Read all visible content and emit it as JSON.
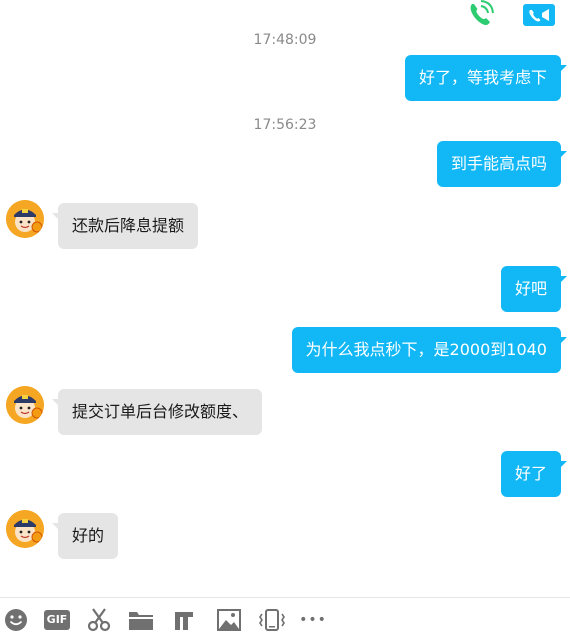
{
  "header": {
    "call_icon": "phone-call-icon",
    "video_icon": "video-call-icon",
    "accent_call": "#2ecc71",
    "accent_video": "#12b7f5"
  },
  "messages": [
    {
      "type": "time",
      "text": "17:48:09"
    },
    {
      "type": "out",
      "text": "好了，等我考虑下"
    },
    {
      "type": "time",
      "text": "17:56:23"
    },
    {
      "type": "out",
      "text": "到手能高点吗"
    },
    {
      "type": "in",
      "text": "还款后降息提额"
    },
    {
      "type": "out",
      "text": "好吧"
    },
    {
      "type": "out",
      "text": "为什么我点秒下，是2000到1040"
    },
    {
      "type": "in",
      "text": "提交订单后台修改额度、"
    },
    {
      "type": "out",
      "text": "好了"
    },
    {
      "type": "in",
      "text": "好的"
    }
  ],
  "toolbar": {
    "icons": [
      "emoji-icon",
      "gif-icon",
      "screenshot-scissors-icon",
      "folder-icon",
      "rich-text-icon",
      "image-icon",
      "shake-icon",
      "more-icon"
    ],
    "gif_label": "GIF",
    "more_label": "•••"
  },
  "colors": {
    "outgoing_bubble": "#12b7f5",
    "incoming_bubble": "#e5e5e5",
    "timestamp": "#8a8a8a"
  }
}
